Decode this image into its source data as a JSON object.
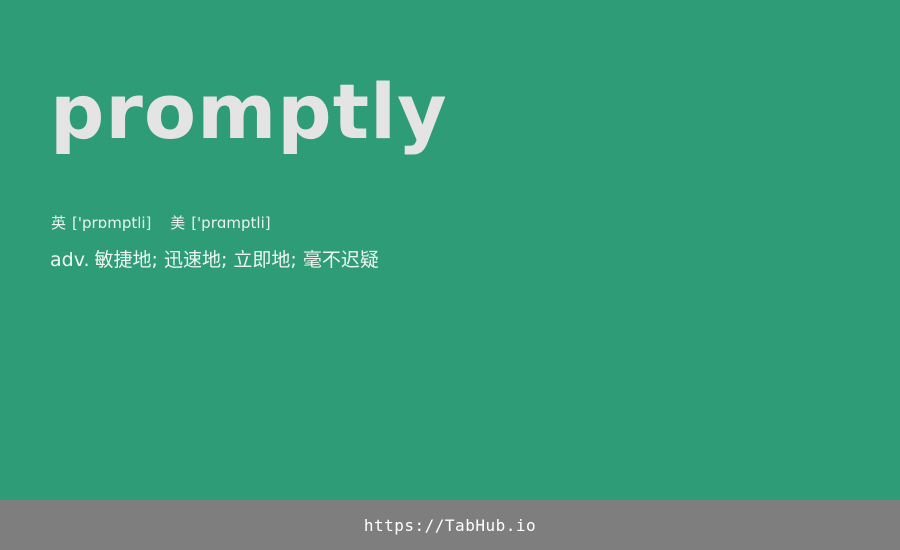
{
  "word": "promptly",
  "phonetics": {
    "uk": {
      "label": "英",
      "ipa": "['prɒmptli]"
    },
    "us": {
      "label": "美",
      "ipa": "['prɑmptli]"
    }
  },
  "definition": {
    "pos": "adv.",
    "meaning": "敏捷地; 迅速地; 立即地; 毫不迟疑"
  },
  "footer": {
    "url": "https://TabHub.io"
  },
  "colors": {
    "background": "#2e9c76",
    "footer_background": "#7f7e7e",
    "word_text": "#e4e4e4"
  }
}
